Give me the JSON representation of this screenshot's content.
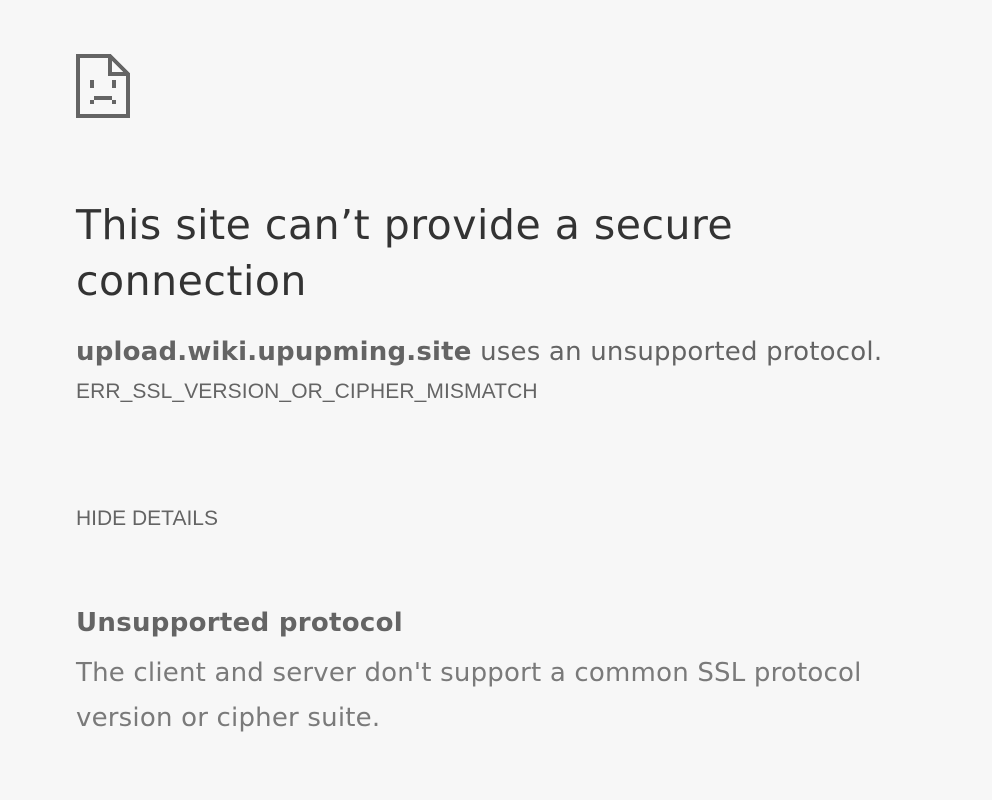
{
  "icon": "sad-page-icon",
  "colors": {
    "background": "#f7f7f7",
    "title": "#333333",
    "body_text": "#646464",
    "detail_text": "#7a7a7a",
    "icon": "#646464"
  },
  "error": {
    "title": "This site can’t provide a secure connection",
    "host": "upload.wiki.upupming.site",
    "summary_suffix": " uses an unsupported protocol.",
    "code": "ERR_SSL_VERSION_OR_CIPHER_MISMATCH"
  },
  "details_button_label": "HIDE DETAILS",
  "details": {
    "heading": "Unsupported protocol",
    "text": "The client and server don't support a common SSL protocol version or cipher suite."
  }
}
